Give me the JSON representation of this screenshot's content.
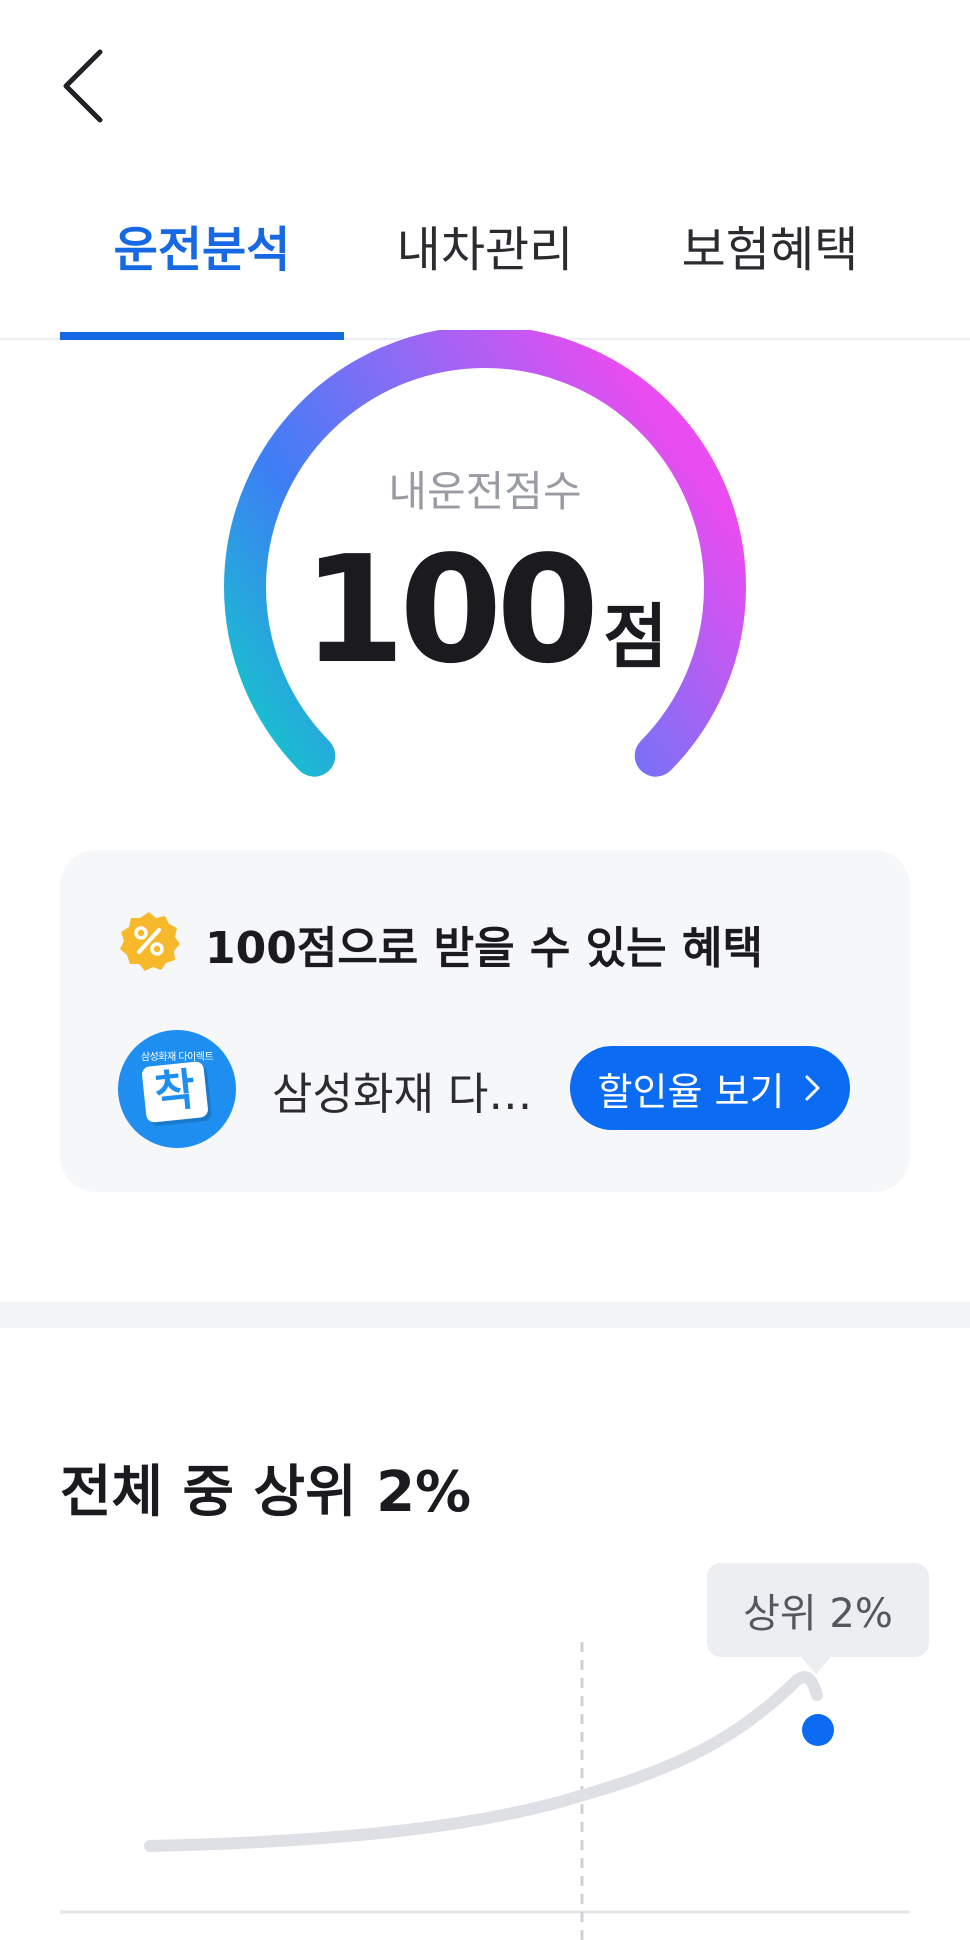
{
  "header": {
    "back_icon": "chevron-left-icon"
  },
  "tabs": [
    {
      "label": "운전분석",
      "active": true
    },
    {
      "label": "내차관리",
      "active": false
    },
    {
      "label": "보험혜택",
      "active": false
    }
  ],
  "score_gauge": {
    "label": "내운전점수",
    "score": "100",
    "unit": "점",
    "fill_fraction": 1.0,
    "gradient_colors": [
      "#14c9c9",
      "#3d7ef5",
      "#8a6cf5",
      "#e94cf0"
    ]
  },
  "benefit_card": {
    "badge_icon": "discount-badge-icon",
    "title": "100점으로 받을 수 있는 혜택",
    "insurer": {
      "logo_icon": "samsung-direct-logo",
      "logo_caption": "삼성화재 다이렉트",
      "logo_letter": "착",
      "name": "삼성화재 다…"
    },
    "button_label": "할인율 보기"
  },
  "ranking": {
    "title": "전체 중 상위 2%",
    "tooltip": "상위 2%",
    "percentile": 2
  },
  "colors": {
    "accent": "#1668e3",
    "button": "#0b6bf2",
    "card_bg": "#f6f7f9"
  }
}
